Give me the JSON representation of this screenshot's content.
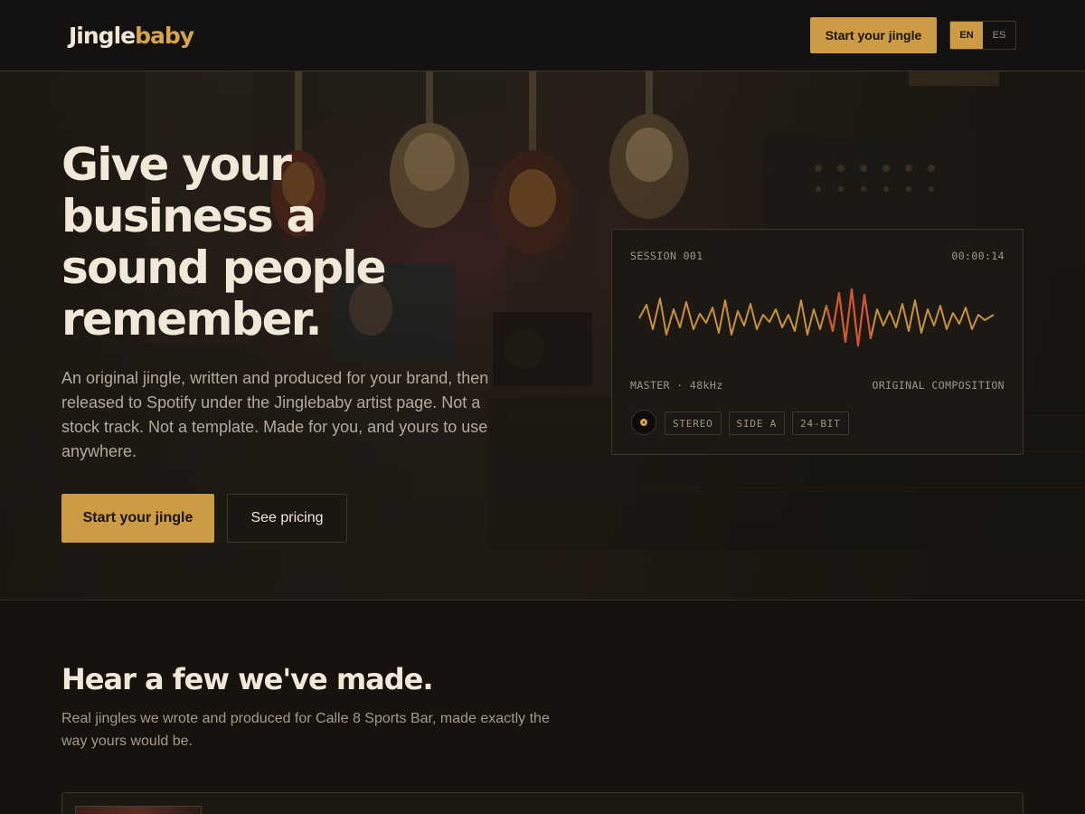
{
  "nav": {
    "logo_part1": "Jingle",
    "logo_part2": "baby",
    "cta_label": "Start your jingle",
    "lang_active": "EN",
    "lang_other": "ES"
  },
  "hero": {
    "title": "Give your\nbusiness a\nsound people\nremember.",
    "subtitle": "An original jingle, written and produced for your brand, then released to Spotify under the Jinglebaby artist page. Not a stock track. Not a template. Made for you, and yours to use anywhere.",
    "primary_button": "Start your jingle",
    "secondary_button": "See pricing"
  },
  "session_card": {
    "session": "SESSION 001",
    "time": "00:00:14",
    "master": "MASTER · 48kHz",
    "composition": "ORIGINAL COMPOSITION",
    "tags": [
      "STEREO",
      "SIDE A",
      "24-BIT"
    ]
  },
  "section": {
    "title": "Hear a few we've made.",
    "subtitle": "Real jingles we wrote and produced for Calle 8 Sports Bar, made exactly the way yours would be."
  },
  "colors": {
    "accent": "#cd9b43",
    "wave_primary": "#c8923c",
    "wave_highlight": "#d2562e",
    "background": "#16130e"
  },
  "icons": {
    "vinyl": "vinyl-record-icon"
  }
}
